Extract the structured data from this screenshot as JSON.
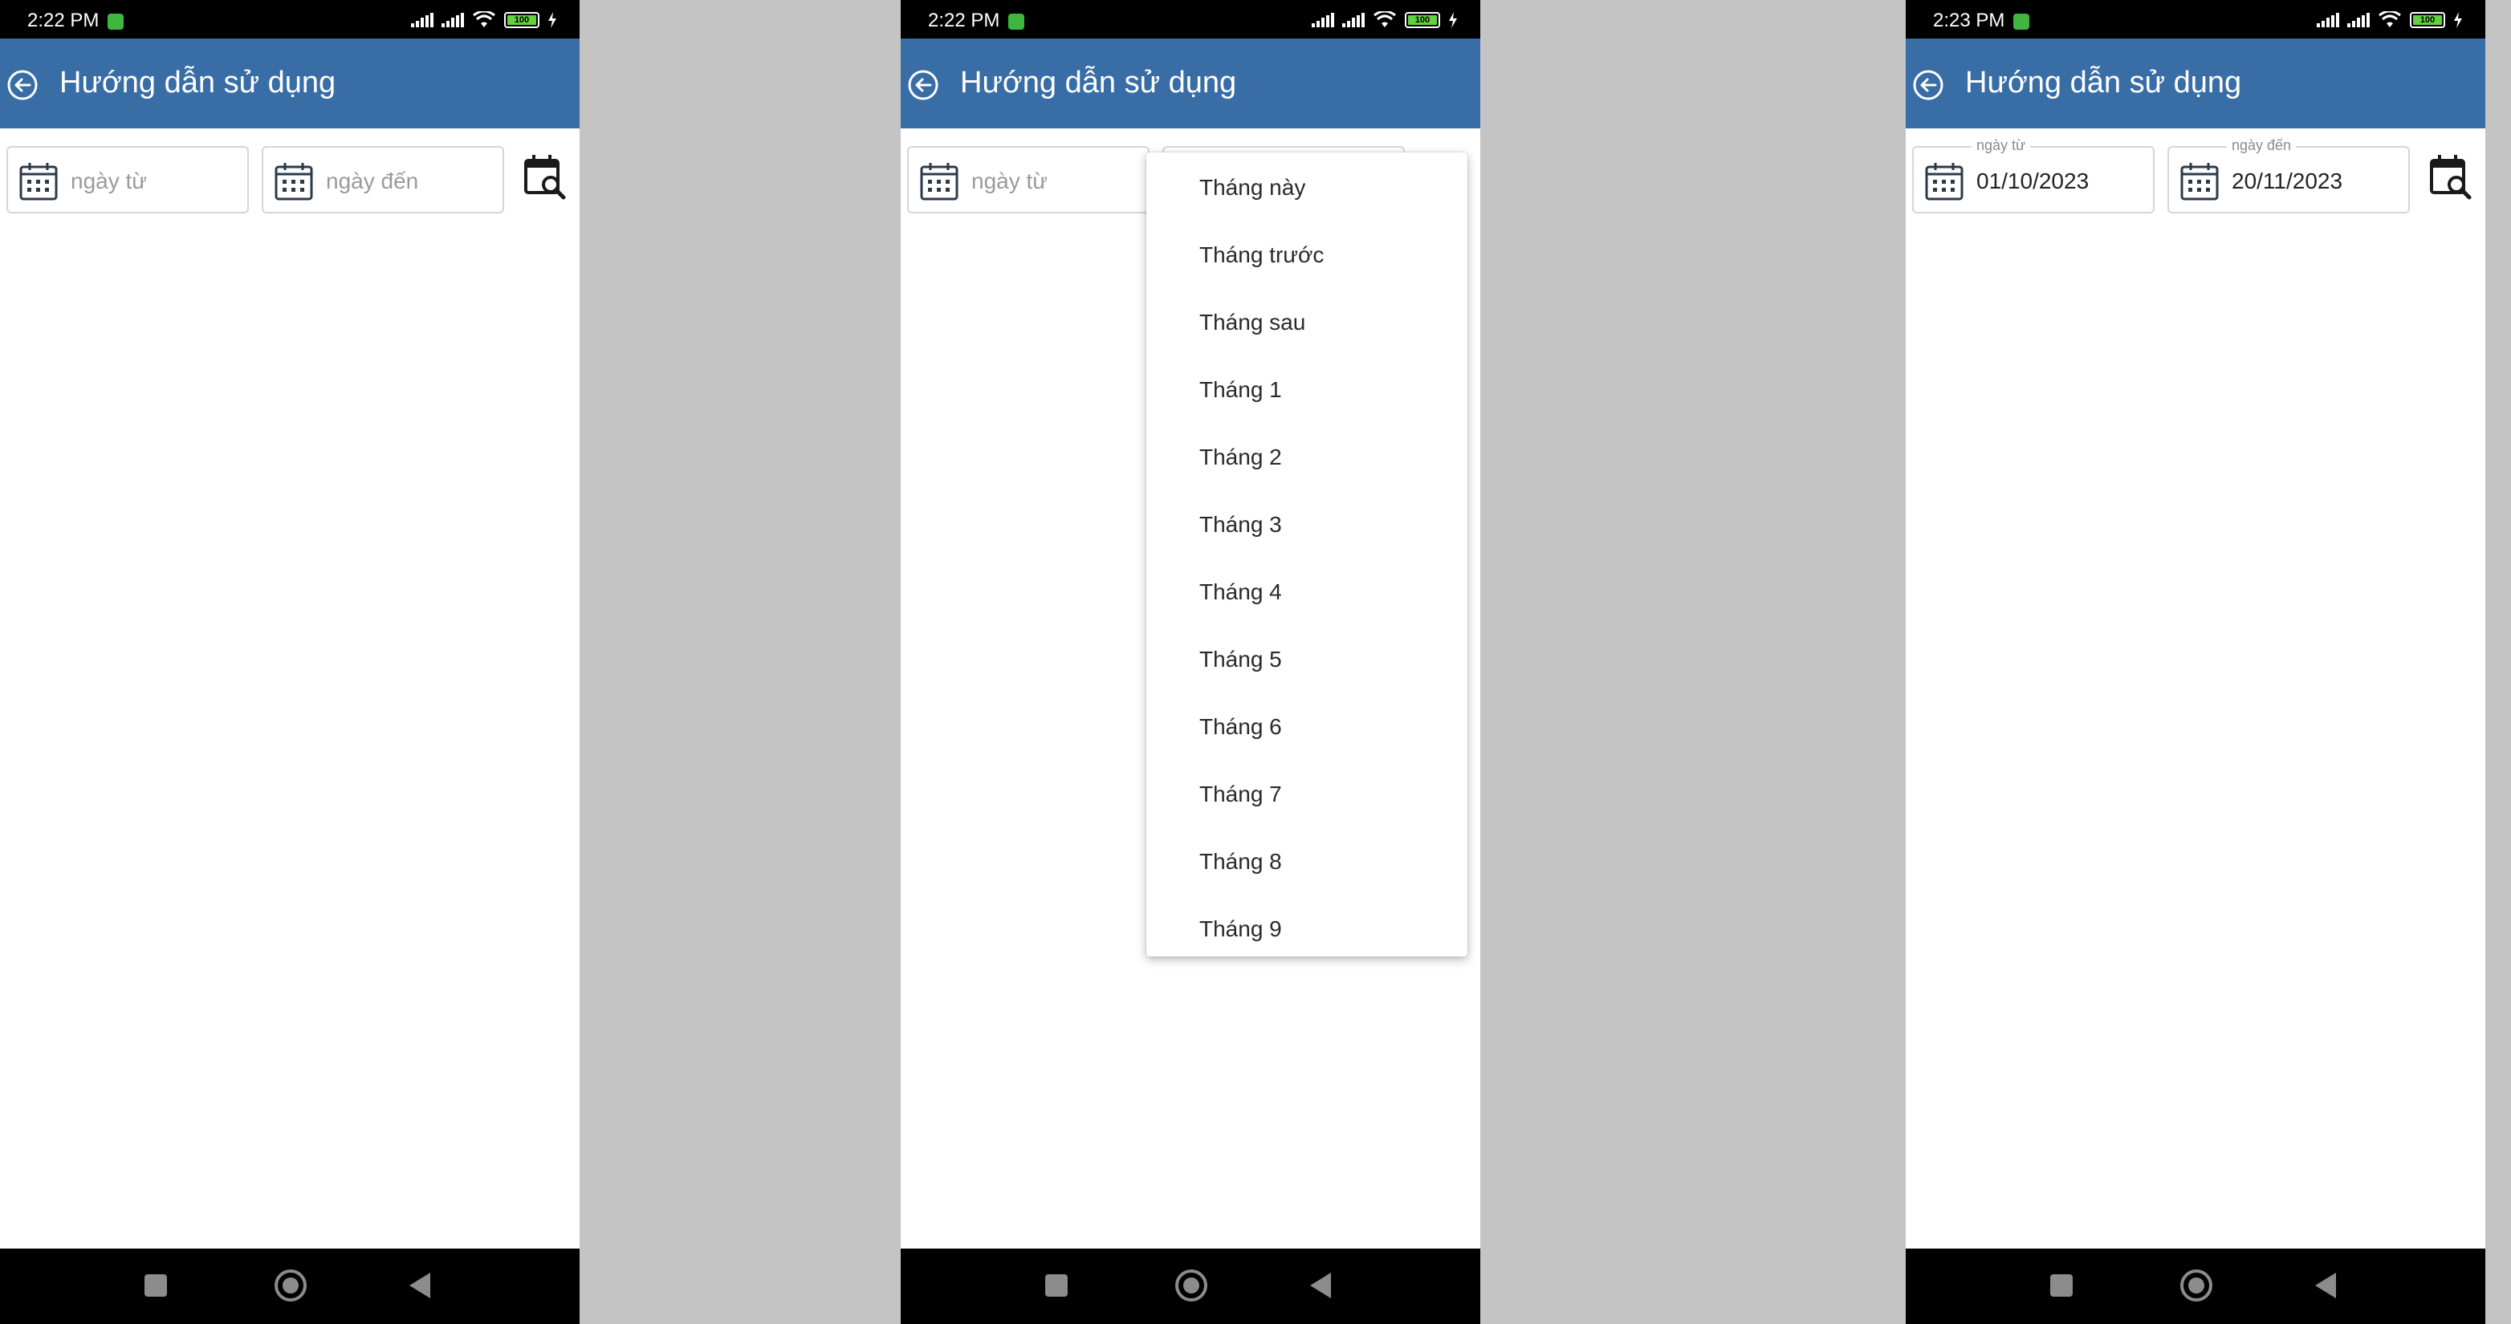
{
  "status": {
    "screen1_time": "2:22 PM",
    "screen2_time": "2:22 PM",
    "screen3_time": "2:23 PM",
    "battery": "100"
  },
  "appbar": {
    "title": "Hướng dẫn sử dụng"
  },
  "filters": {
    "from_placeholder": "ngày từ",
    "to_placeholder": "ngày đến",
    "from_label": "ngày từ",
    "to_label": "ngày đến",
    "from_value": "01/10/2023",
    "to_value": "20/11/2023"
  },
  "dropdown": {
    "items": [
      "Tháng này",
      "Tháng trước",
      "Tháng sau",
      "Tháng 1",
      "Tháng 2",
      "Tháng 3",
      "Tháng 4",
      "Tháng 5",
      "Tháng 6",
      "Tháng 7",
      "Tháng 8",
      "Tháng 9"
    ]
  },
  "colors": {
    "appbar": "#386da6",
    "gutter": "#c4c4c4"
  },
  "icons": [
    "back-arrow-icon",
    "calendar-icon",
    "calendar-search-icon",
    "wifi-icon",
    "signal-icon",
    "battery-icon"
  ]
}
